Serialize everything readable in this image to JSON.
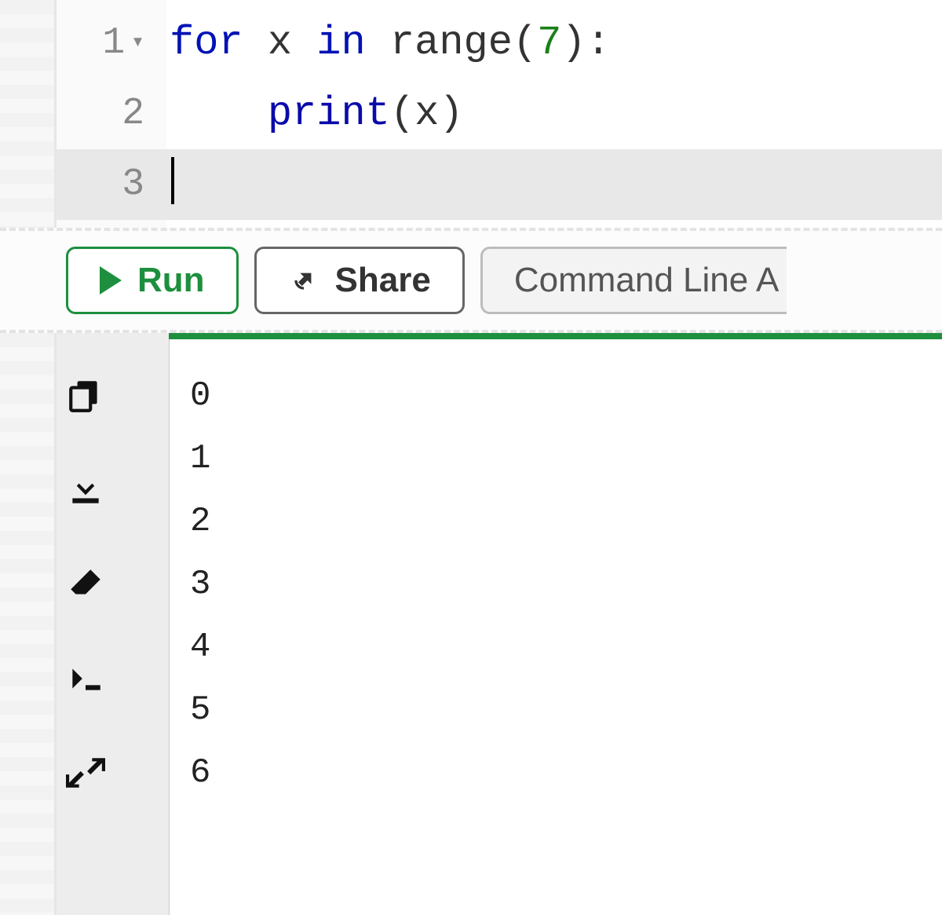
{
  "editor": {
    "lines": [
      {
        "num": "1",
        "foldable": true,
        "active": false,
        "tokens": [
          {
            "t": "for",
            "c": "tok-kw"
          },
          {
            "t": " ",
            "c": ""
          },
          {
            "t": "x",
            "c": "tok-id"
          },
          {
            "t": " ",
            "c": ""
          },
          {
            "t": "in",
            "c": "tok-kw"
          },
          {
            "t": " ",
            "c": ""
          },
          {
            "t": "range",
            "c": "tok-id"
          },
          {
            "t": "(",
            "c": "tok-punc"
          },
          {
            "t": "7",
            "c": "tok-num"
          },
          {
            "t": ")",
            "c": "tok-punc"
          },
          {
            "t": ":",
            "c": "tok-punc"
          }
        ]
      },
      {
        "num": "2",
        "foldable": false,
        "active": false,
        "tokens": [
          {
            "t": "    ",
            "c": ""
          },
          {
            "t": "print",
            "c": "tok-fn"
          },
          {
            "t": "(",
            "c": "tok-punc"
          },
          {
            "t": "x",
            "c": "tok-id"
          },
          {
            "t": ")",
            "c": "tok-punc"
          }
        ]
      },
      {
        "num": "3",
        "foldable": false,
        "active": true,
        "cursor": true,
        "tokens": []
      }
    ]
  },
  "toolbar": {
    "run_label": "Run",
    "share_label": "Share",
    "cmd_label": "Command Line A"
  },
  "output_icons": [
    "copy-icon",
    "download-icon",
    "eraser-icon",
    "terminal-icon",
    "fullscreen-icon"
  ],
  "output_text": "0\n1\n2\n3\n4\n5\n6"
}
